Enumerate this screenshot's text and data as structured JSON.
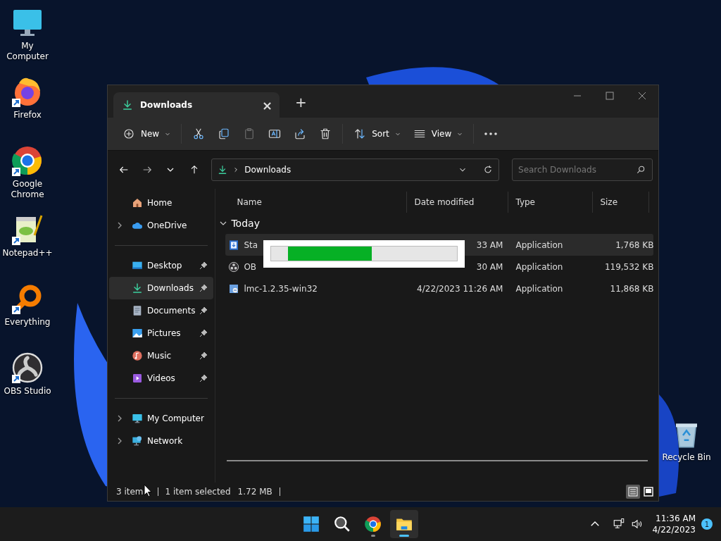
{
  "desktop_icons": [
    {
      "label": "My Computer",
      "kind": "computer",
      "shortcut": false
    },
    {
      "label": "Firefox",
      "kind": "firefox",
      "shortcut": true
    },
    {
      "label": "Google Chrome",
      "kind": "chrome",
      "shortcut": true
    },
    {
      "label": "Notepad++",
      "kind": "notepad",
      "shortcut": true
    },
    {
      "label": "Everything",
      "kind": "everything",
      "shortcut": true
    },
    {
      "label": "OBS Studio",
      "kind": "obs",
      "shortcut": true
    }
  ],
  "recycle_bin": {
    "label": "Recycle Bin"
  },
  "window": {
    "tabs": [
      {
        "title": "Downloads",
        "selected": true,
        "close": "×"
      }
    ],
    "new_tab": "+",
    "toolbar": [
      {
        "kind": "new",
        "label": "New",
        "disabled": false
      },
      {
        "kind": "cut",
        "disabled": false
      },
      {
        "kind": "copy",
        "disabled": false
      },
      {
        "kind": "paste",
        "disabled": true
      },
      {
        "kind": "rename",
        "disabled": false
      },
      {
        "kind": "share",
        "disabled": false
      },
      {
        "kind": "delete",
        "disabled": false
      },
      {
        "kind": "sort",
        "label": "Sort",
        "disabled": false
      },
      {
        "kind": "view",
        "label": "View",
        "disabled": false
      },
      {
        "kind": "more",
        "disabled": false
      }
    ],
    "address": {
      "path": "Downloads"
    },
    "search": {
      "placeholder": "Search Downloads"
    },
    "sidebar": [
      [
        {
          "label": "Home",
          "kind": "home",
          "expandable": false,
          "pinned": false,
          "selected": false
        },
        {
          "label": "OneDrive",
          "kind": "cloud",
          "expandable": true,
          "pinned": false,
          "selected": false
        }
      ],
      [
        {
          "label": "Desktop",
          "kind": "desktop",
          "expandable": false,
          "pinned": true,
          "selected": false
        },
        {
          "label": "Downloads",
          "kind": "download",
          "expandable": false,
          "pinned": true,
          "selected": true
        },
        {
          "label": "Documents",
          "kind": "document",
          "expandable": false,
          "pinned": true,
          "selected": false
        },
        {
          "label": "Pictures",
          "kind": "picture",
          "expandable": false,
          "pinned": true,
          "selected": false
        },
        {
          "label": "Music",
          "kind": "music",
          "expandable": false,
          "pinned": true,
          "selected": false
        },
        {
          "label": "Videos",
          "kind": "video",
          "expandable": false,
          "pinned": true,
          "selected": false
        }
      ],
      [
        {
          "label": "My Computer",
          "kind": "computer",
          "expandable": true,
          "pinned": false,
          "selected": false
        },
        {
          "label": "Network",
          "kind": "network",
          "expandable": true,
          "pinned": false,
          "selected": false
        }
      ]
    ],
    "columns": [
      "Name",
      "Date modified",
      "Type",
      "Size"
    ],
    "group": "Today",
    "files": [
      {
        "name": "Sta",
        "date": "33 AM",
        "type": "Application",
        "size": "1,768 KB",
        "kind": "setup",
        "selected": true
      },
      {
        "name": "OB",
        "date": "30 AM",
        "type": "Application",
        "size": "119,532 KB",
        "kind": "obs",
        "selected": false
      },
      {
        "name": "lmc-1.2.35-win32",
        "date": "4/22/2023 11:26 AM",
        "type": "Application",
        "size": "11,868 KB",
        "kind": "installer",
        "selected": false
      }
    ],
    "status": {
      "count": "3 item",
      "selection": "1 item selected",
      "size": "1.72 MB"
    },
    "view_modes": [
      {
        "kind": "details",
        "selected": true
      },
      {
        "kind": "tiles",
        "selected": false
      }
    ]
  },
  "taskbar": {
    "apps": [
      {
        "kind": "start",
        "active": false
      },
      {
        "kind": "search",
        "active": false
      },
      {
        "kind": "chrome",
        "active": false,
        "running": true
      },
      {
        "kind": "explorer",
        "active": true,
        "running": true
      }
    ],
    "time": "11:36 AM",
    "date": "4/22/2023",
    "notifications": "1"
  }
}
